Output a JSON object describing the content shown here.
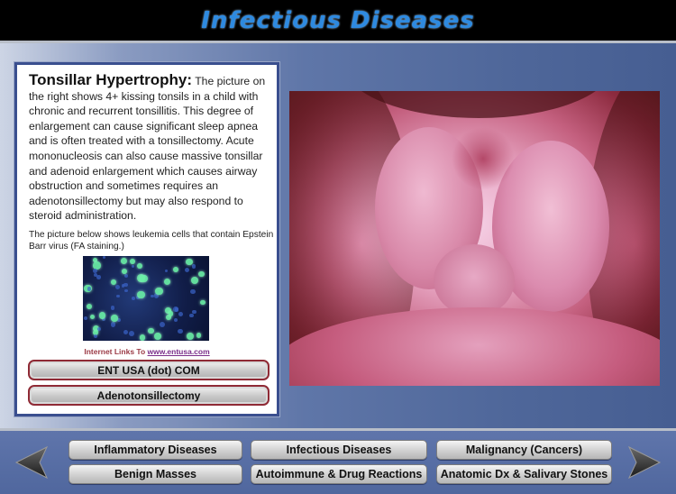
{
  "header": {
    "title": "Infectious Diseases"
  },
  "info": {
    "heading": "Tonsillar Hypertrophy:",
    "body": "The picture on the right shows 4+ kissing tonsils in a child with chronic and recurrent tonsillitis.  This degree of enlargement can cause significant sleep apnea and is often treated with a tonsillectomy.   Acute mononucleosis can also cause massive tonsillar and adenoid enlargement which causes airway obstruction and sometimes requires an adenotonsillectomy but may also respond to steroid administration.",
    "caption": "The picture below shows leukemia cells that contain Epstein Barr virus (FA staining.)",
    "links_prefix": "Internet Links To ",
    "links_url": "www.entusa.com",
    "buttons": [
      {
        "label": "ENT USA (dot) COM"
      },
      {
        "label": "Adenotonsillectomy"
      }
    ]
  },
  "nav": {
    "categories": [
      {
        "label": "Inflammatory  Diseases"
      },
      {
        "label": "Infectious  Diseases"
      },
      {
        "label": "Malignancy (Cancers)"
      },
      {
        "label": "Benign Masses"
      },
      {
        "label": "Autoimmune & Drug Reactions"
      },
      {
        "label": "Anatomic Dx & Salivary Stones"
      }
    ],
    "prev_icon": "left-arrow-icon",
    "next_icon": "right-arrow-icon"
  },
  "colors": {
    "title": "#2e8ae0",
    "panel_border": "#3a4f8f",
    "link_button_border": "#8f2a35",
    "link_caption": "#9b3a45"
  }
}
